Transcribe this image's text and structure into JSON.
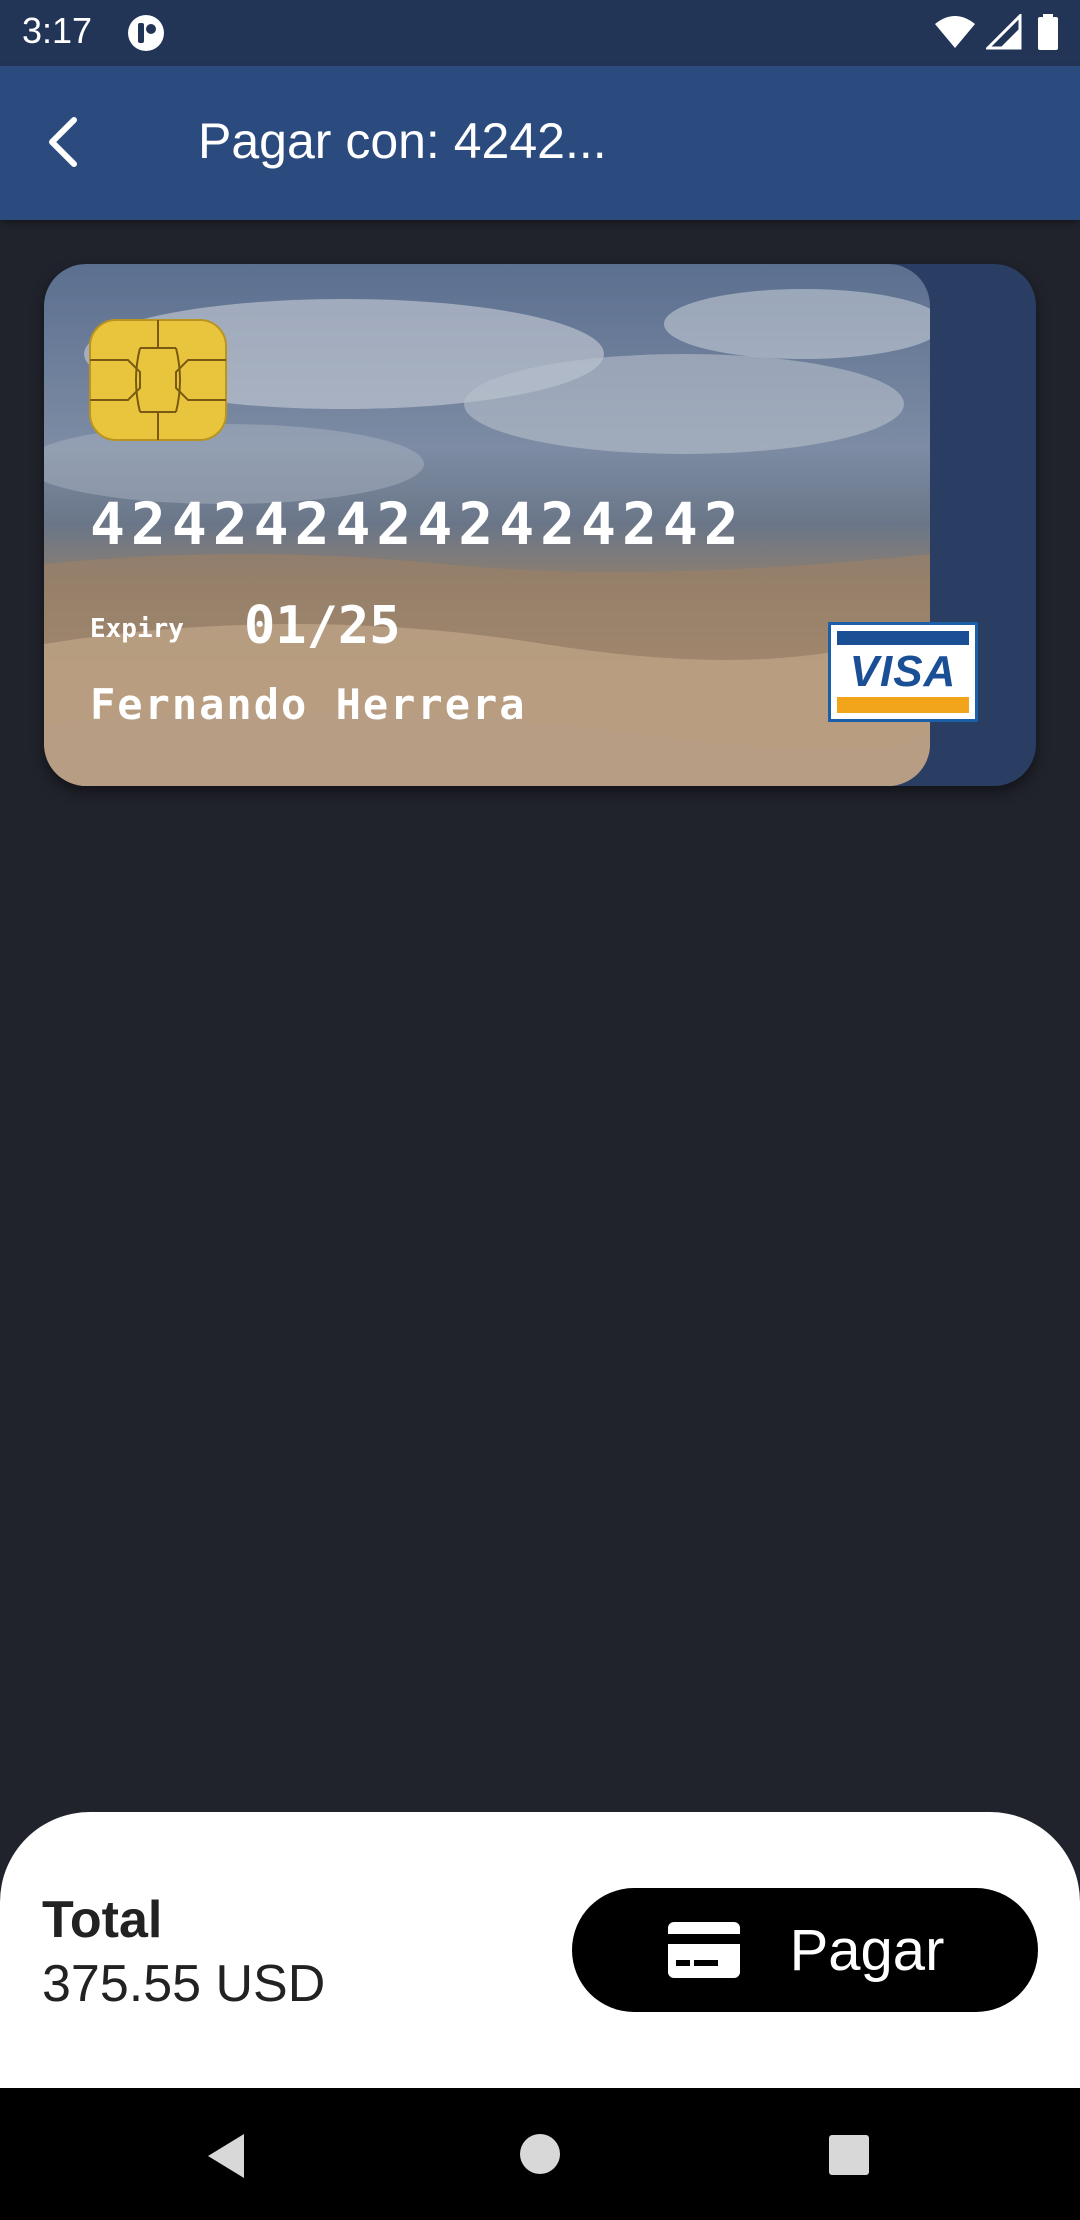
{
  "status_bar": {
    "time": "3:17",
    "icons": [
      "app-notification-icon",
      "wifi-icon",
      "signal-icon",
      "battery-icon"
    ]
  },
  "app_bar": {
    "title": "Pagar con: 4242...",
    "back_icon": "arrow-back-icon"
  },
  "card": {
    "number": "4242424242424242",
    "expiry_label": "Expiry",
    "expiry_value": "01/25",
    "holder_name": "Fernando Herrera",
    "brand": "VISA",
    "card_color": "#2a3d63"
  },
  "checkout": {
    "total_label": "Total",
    "total_amount": "375.55 USD",
    "pay_button_label": "Pagar",
    "pay_icon": "credit-card-icon"
  },
  "navigation": {
    "buttons": [
      "back",
      "home",
      "recents"
    ]
  },
  "colors": {
    "background": "#21232c",
    "app_bar": "#2b4a7e",
    "status_bar": "#233556",
    "pay_button": "#000000"
  }
}
